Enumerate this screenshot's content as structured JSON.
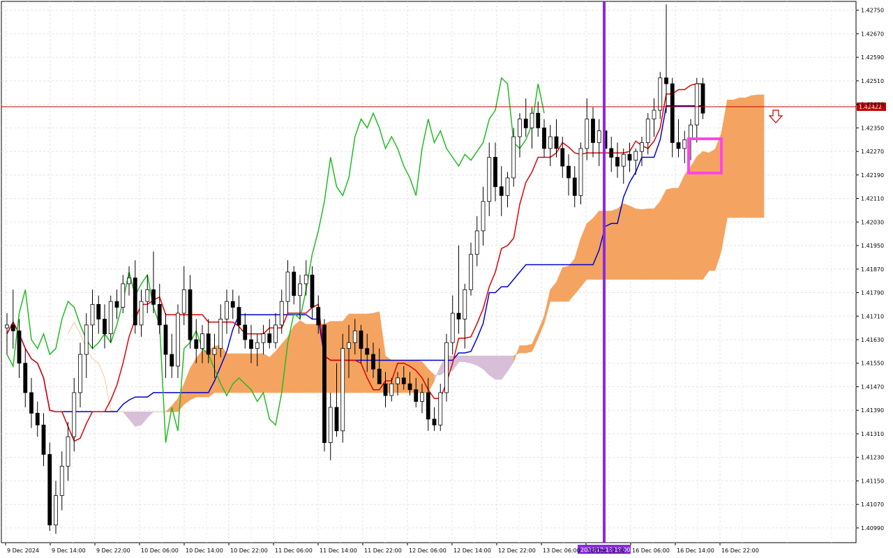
{
  "chart_data": {
    "type": "candlestick",
    "price_axis": {
      "ylim": [
        1.4094,
        1.4278
      ],
      "ticks": [
        "1.42750",
        "1.42670",
        "1.42590",
        "1.42510",
        "1.42430",
        "1.42350",
        "1.42270",
        "1.42190",
        "1.42110",
        "1.42030",
        "1.41950",
        "1.41870",
        "1.41790",
        "1.41710",
        "1.41630",
        "1.41550",
        "1.41470",
        "1.41390",
        "1.41310",
        "1.41230",
        "1.41150",
        "1.41070",
        "1.40990"
      ]
    },
    "time_axis": {
      "labels": [
        "9 Dec 2024",
        "9 Dec 14:00",
        "9 Dec 22:00",
        "10 Dec 06:00",
        "10 Dec 14:00",
        "10 Dec 22:00",
        "11 Dec 06:00",
        "11 Dec 14:00",
        "11 Dec 22:00",
        "12 Dec 06:00",
        "12 Dec 14:00",
        "12 Dec 22:00",
        "13 Dec 06:00",
        "16 Dec 22:00",
        "16 Dec 06:00",
        "16 Dec 14:00",
        "16 Dec 22:00"
      ],
      "cursor_label": "2024.12.13 18:00"
    },
    "current_price": {
      "value": 1.42422,
      "label": "1.42422"
    },
    "grid": true,
    "colors": {
      "tenkan": "#e00000",
      "kijun": "#0000d0",
      "chikou": "#22bb22",
      "cloud_bull": "#f4a460",
      "cloud_bear": "#d8bfd8",
      "cursor": "#8a2be2",
      "price_line": "#c00000",
      "highlight": "#ff44ee",
      "bull_candle": "#ffffff",
      "bear_candle": "#000000"
    },
    "candles": [
      [
        1.4167,
        1.4172,
        1.4158,
        1.4168
      ],
      [
        1.4168,
        1.418,
        1.416,
        1.4166
      ],
      [
        1.4166,
        1.417,
        1.415,
        1.4155
      ],
      [
        1.4155,
        1.416,
        1.414,
        1.4145
      ],
      [
        1.4145,
        1.415,
        1.4133,
        1.4138
      ],
      [
        1.4138,
        1.4142,
        1.413,
        1.4134
      ],
      [
        1.4134,
        1.4138,
        1.412,
        1.4124
      ],
      [
        1.4124,
        1.4128,
        1.4098,
        1.41
      ],
      [
        1.41,
        1.4115,
        1.4097,
        1.411
      ],
      [
        1.411,
        1.4125,
        1.4105,
        1.412
      ],
      [
        1.412,
        1.4135,
        1.4115,
        1.413
      ],
      [
        1.413,
        1.415,
        1.4125,
        1.4145
      ],
      [
        1.4145,
        1.4162,
        1.414,
        1.4158
      ],
      [
        1.4158,
        1.4172,
        1.415,
        1.4168
      ],
      [
        1.4168,
        1.418,
        1.416,
        1.4175
      ],
      [
        1.4175,
        1.4178,
        1.4165,
        1.417
      ],
      [
        1.417,
        1.4175,
        1.416,
        1.4165
      ],
      [
        1.4165,
        1.4178,
        1.4162,
        1.4176
      ],
      [
        1.4176,
        1.418,
        1.417,
        1.4174
      ],
      [
        1.4174,
        1.4185,
        1.4172,
        1.4182
      ],
      [
        1.4182,
        1.4188,
        1.4178,
        1.4184
      ],
      [
        1.4184,
        1.419,
        1.4165,
        1.4168
      ],
      [
        1.4168,
        1.418,
        1.4164,
        1.4176
      ],
      [
        1.4176,
        1.4185,
        1.4172,
        1.418
      ],
      [
        1.418,
        1.4193,
        1.4172,
        1.4175
      ],
      [
        1.4175,
        1.4182,
        1.4165,
        1.4168
      ],
      [
        1.4168,
        1.4172,
        1.415,
        1.4158
      ],
      [
        1.4158,
        1.4165,
        1.415,
        1.4154
      ],
      [
        1.4154,
        1.4175,
        1.415,
        1.4172
      ],
      [
        1.4172,
        1.4188,
        1.4168,
        1.418
      ],
      [
        1.418,
        1.4185,
        1.416,
        1.4163
      ],
      [
        1.4163,
        1.417,
        1.4155,
        1.416
      ],
      [
        1.416,
        1.4168,
        1.4155,
        1.4165
      ],
      [
        1.4165,
        1.417,
        1.4155,
        1.4158
      ],
      [
        1.4158,
        1.4165,
        1.415,
        1.416
      ],
      [
        1.416,
        1.4175,
        1.4157,
        1.417
      ],
      [
        1.417,
        1.418,
        1.4165,
        1.4176
      ],
      [
        1.4176,
        1.418,
        1.417,
        1.4174
      ],
      [
        1.4174,
        1.4178,
        1.4165,
        1.4168
      ],
      [
        1.4168,
        1.4172,
        1.416,
        1.4163
      ],
      [
        1.4163,
        1.4168,
        1.4155,
        1.416
      ],
      [
        1.416,
        1.4165,
        1.4154,
        1.4162
      ],
      [
        1.4162,
        1.4168,
        1.4158,
        1.4165
      ],
      [
        1.4165,
        1.417,
        1.416,
        1.4162
      ],
      [
        1.4162,
        1.4172,
        1.416,
        1.4168
      ],
      [
        1.4168,
        1.418,
        1.4165,
        1.4176
      ],
      [
        1.4176,
        1.419,
        1.4172,
        1.4186
      ],
      [
        1.4186,
        1.4188,
        1.4175,
        1.4178
      ],
      [
        1.4178,
        1.4185,
        1.417,
        1.4182
      ],
      [
        1.4182,
        1.419,
        1.4178,
        1.4185
      ],
      [
        1.4185,
        1.4188,
        1.417,
        1.4174
      ],
      [
        1.4174,
        1.4178,
        1.4165,
        1.4168
      ],
      [
        1.4168,
        1.417,
        1.4125,
        1.4128
      ],
      [
        1.4128,
        1.4145,
        1.4122,
        1.414
      ],
      [
        1.414,
        1.4155,
        1.413,
        1.4132
      ],
      [
        1.4132,
        1.4165,
        1.4128,
        1.416
      ],
      [
        1.416,
        1.4168,
        1.415,
        1.4162
      ],
      [
        1.4162,
        1.417,
        1.4158,
        1.4166
      ],
      [
        1.4166,
        1.4168,
        1.4155,
        1.416
      ],
      [
        1.416,
        1.4165,
        1.4152,
        1.4158
      ],
      [
        1.4158,
        1.4162,
        1.415,
        1.4153
      ],
      [
        1.4153,
        1.416,
        1.4148,
        1.4148
      ],
      [
        1.4148,
        1.4152,
        1.414,
        1.4144
      ],
      [
        1.4144,
        1.415,
        1.4142,
        1.4148
      ],
      [
        1.4148,
        1.4152,
        1.4144,
        1.415
      ],
      [
        1.415,
        1.4154,
        1.4146,
        1.4148
      ],
      [
        1.4148,
        1.4152,
        1.4144,
        1.4146
      ],
      [
        1.4146,
        1.415,
        1.414,
        1.4142
      ],
      [
        1.4142,
        1.4148,
        1.4138,
        1.4145
      ],
      [
        1.4145,
        1.415,
        1.4132,
        1.4136
      ],
      [
        1.4136,
        1.414,
        1.4132,
        1.4134
      ],
      [
        1.4134,
        1.4148,
        1.4132,
        1.4145
      ],
      [
        1.4145,
        1.4165,
        1.4142,
        1.4162
      ],
      [
        1.4162,
        1.4178,
        1.4158,
        1.4172
      ],
      [
        1.4172,
        1.4195,
        1.4165,
        1.417
      ],
      [
        1.417,
        1.4182,
        1.416,
        1.418
      ],
      [
        1.418,
        1.4196,
        1.4178,
        1.4192
      ],
      [
        1.4192,
        1.4205,
        1.4188,
        1.42
      ],
      [
        1.42,
        1.4215,
        1.4195,
        1.421
      ],
      [
        1.421,
        1.423,
        1.4205,
        1.4225
      ],
      [
        1.4225,
        1.423,
        1.421,
        1.4215
      ],
      [
        1.4215,
        1.4222,
        1.4205,
        1.4212
      ],
      [
        1.4212,
        1.422,
        1.4208,
        1.4218
      ],
      [
        1.4218,
        1.4235,
        1.4215,
        1.4232
      ],
      [
        1.4232,
        1.424,
        1.4225,
        1.4238
      ],
      [
        1.4238,
        1.4245,
        1.4232,
        1.4235
      ],
      [
        1.4235,
        1.4242,
        1.4228,
        1.424
      ],
      [
        1.424,
        1.4244,
        1.4232,
        1.4235
      ],
      [
        1.4235,
        1.4238,
        1.4225,
        1.4228
      ],
      [
        1.4228,
        1.4236,
        1.4222,
        1.4232
      ],
      [
        1.4232,
        1.4238,
        1.4225,
        1.4228
      ],
      [
        1.4228,
        1.4232,
        1.4218,
        1.4222
      ],
      [
        1.4222,
        1.4226,
        1.4212,
        1.4218
      ],
      [
        1.4218,
        1.4222,
        1.4208,
        1.4212
      ],
      [
        1.4212,
        1.423,
        1.4209,
        1.4228
      ],
      [
        1.4228,
        1.4245,
        1.4224,
        1.4238
      ],
      [
        1.4238,
        1.4242,
        1.4225,
        1.423
      ],
      [
        1.423,
        1.4238,
        1.4222,
        1.4234
      ],
      [
        1.4234,
        1.4238,
        1.4225,
        1.4228
      ],
      [
        1.4228,
        1.4232,
        1.422,
        1.4225
      ],
      [
        1.4225,
        1.423,
        1.4218,
        1.4222
      ],
      [
        1.4222,
        1.4228,
        1.4216,
        1.4226
      ],
      [
        1.4226,
        1.423,
        1.422,
        1.4224
      ],
      [
        1.4224,
        1.4228,
        1.4219,
        1.4227
      ],
      [
        1.4227,
        1.4232,
        1.4222,
        1.423
      ],
      [
        1.423,
        1.424,
        1.4226,
        1.4238
      ],
      [
        1.4238,
        1.4245,
        1.4232,
        1.4241
      ],
      [
        1.4241,
        1.4254,
        1.4238,
        1.4252
      ],
      [
        1.4252,
        1.4277,
        1.424,
        1.425
      ],
      [
        1.425,
        1.4252,
        1.4225,
        1.423
      ],
      [
        1.423,
        1.4238,
        1.4225,
        1.4228
      ],
      [
        1.4228,
        1.4234,
        1.4223,
        1.4231
      ],
      [
        1.4231,
        1.4238,
        1.4224,
        1.4236
      ],
      [
        1.4236,
        1.4252,
        1.423,
        1.425
      ],
      [
        1.425,
        1.4252,
        1.4238,
        1.424
      ]
    ]
  }
}
